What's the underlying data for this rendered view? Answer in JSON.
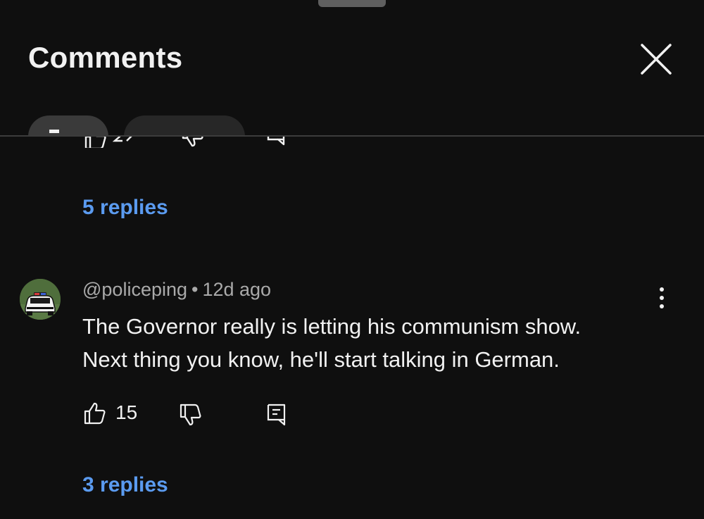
{
  "header": {
    "title": "Comments"
  },
  "icons": {
    "close": "close-icon",
    "like": "thumbs-up-icon",
    "dislike": "thumbs-down-icon",
    "reply": "reply-comment-icon",
    "more": "more-vertical-icon",
    "avatar": "police-car-avatar"
  },
  "colors": {
    "background": "#0f0f0f",
    "link": "#5b9bf0",
    "text": "#f1f1f1",
    "muted": "#aaaaaa"
  },
  "previous_comment": {
    "replies_label": "5 replies"
  },
  "comment": {
    "author": "@policeping",
    "separator": "•",
    "time": "12d ago",
    "text_lines": [
      "The Governor really is letting his communism show.",
      "Next thing you know, he'll start talking in German."
    ],
    "like_count": "15",
    "replies_label": "3 replies"
  }
}
